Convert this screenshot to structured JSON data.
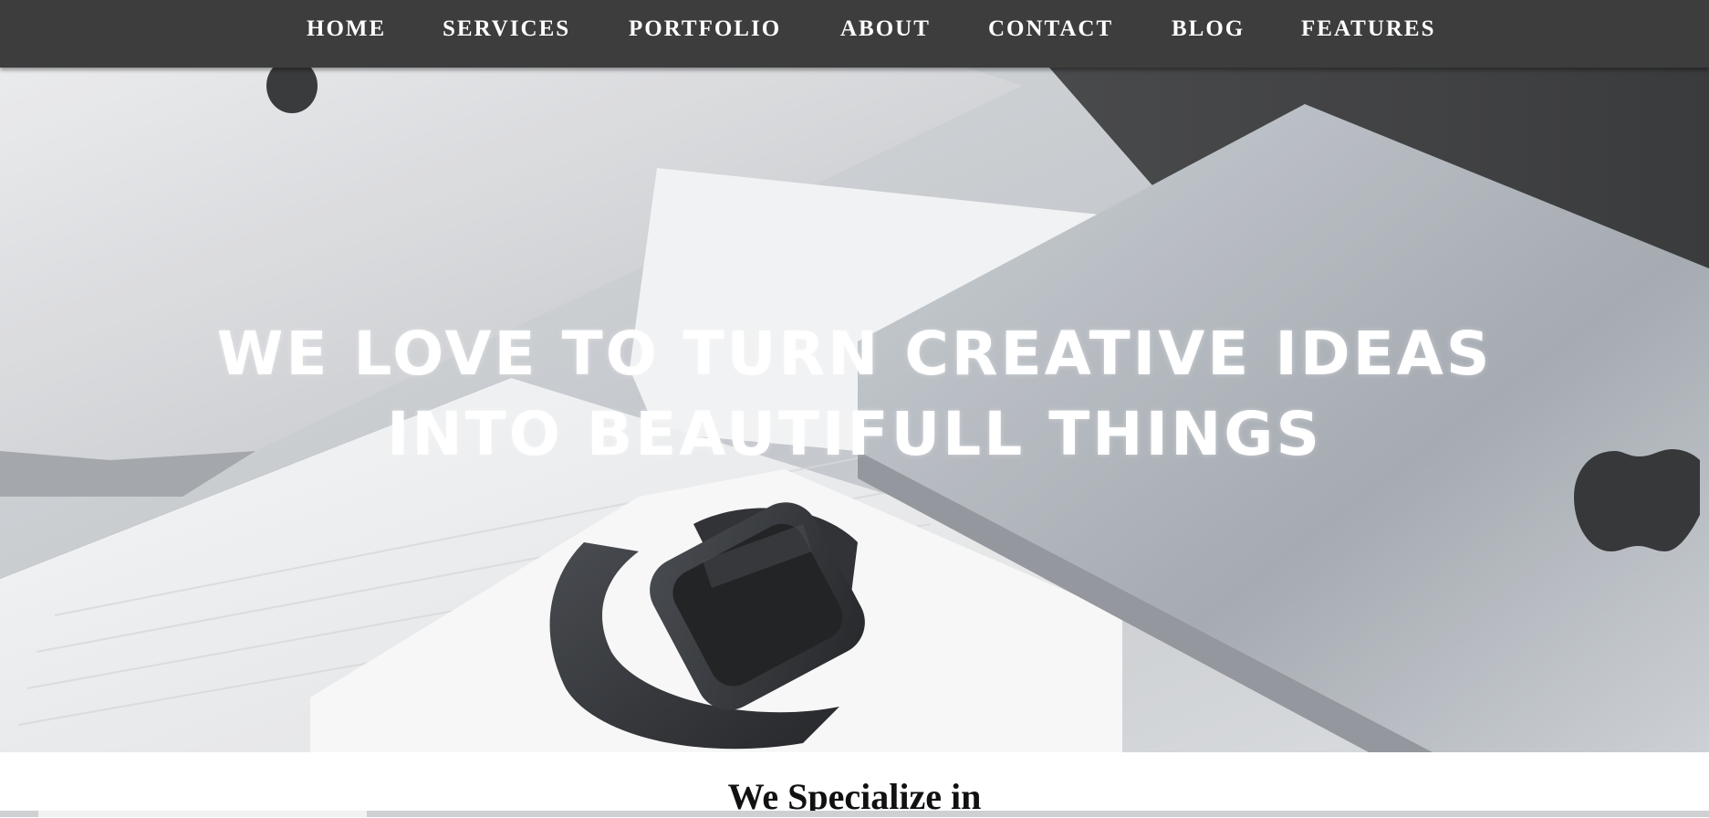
{
  "nav": {
    "items": [
      {
        "label": "HOME"
      },
      {
        "label": "SERVICES"
      },
      {
        "label": "PORTFOLIO"
      },
      {
        "label": "ABOUT"
      },
      {
        "label": "CONTACT"
      },
      {
        "label": "BLOG"
      },
      {
        "label": "FEATURES"
      }
    ]
  },
  "hero": {
    "line1": "WE LOVE TO TURN CREATIVE IDEAS",
    "line2": "INTO BEAUTIFULL THINGS"
  },
  "section": {
    "heading": "We Specialize in"
  },
  "colors": {
    "navbar": "#3d3d3d",
    "nav_text": "#ffffff",
    "hero_text": "#ffffff"
  }
}
